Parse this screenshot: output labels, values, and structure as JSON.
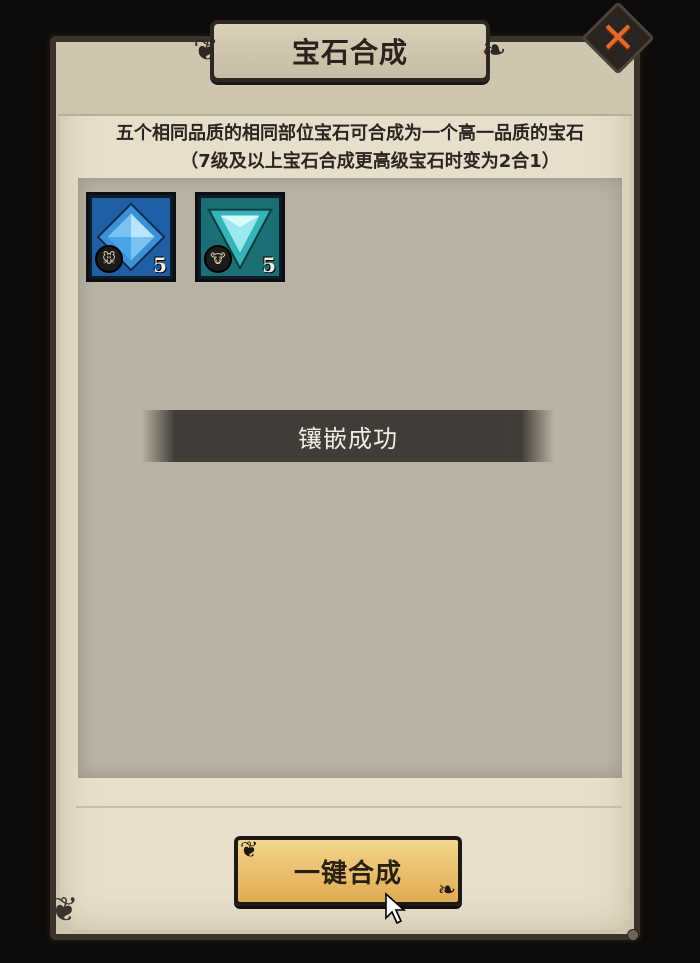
{
  "header": {
    "title": "宝石合成",
    "close_glyph": "✕"
  },
  "description": {
    "line1": "五个相同品质的相同部位宝石可合成为一个高一品质的宝石",
    "line2": "（7级及以上宝石合成更高级宝石时变为2合1）"
  },
  "gems": [
    {
      "icon": "blue-square-gem-icon",
      "level": "5",
      "color": "#3d8fd6",
      "badge_icon": "rat-icon"
    },
    {
      "icon": "teal-triangle-gem-icon",
      "level": "5",
      "color": "#36b2b8",
      "badge_icon": "ox-icon"
    }
  ],
  "toast": {
    "text": "镶嵌成功"
  },
  "footer": {
    "merge_button_label": "一键合成"
  },
  "colors": {
    "panel_bg": "#e7dfcc",
    "grid_bg": "#b9b2a3",
    "button_gold": "#e8bd6a",
    "close_orange": "#e26a2c"
  }
}
